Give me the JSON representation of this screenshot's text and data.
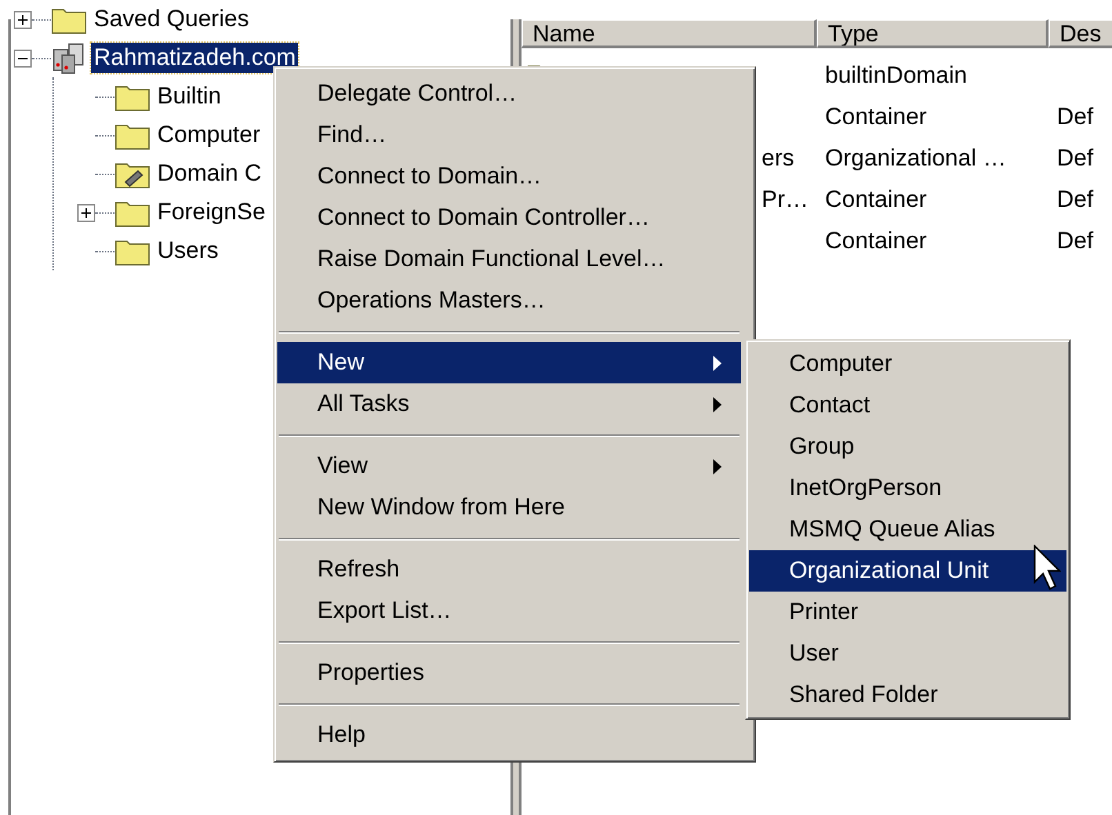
{
  "tree": {
    "items": [
      {
        "label": "Saved Queries",
        "kind": "folder",
        "expanded": false,
        "selected": false
      },
      {
        "label": "Rahmatizadeh.com",
        "kind": "domain",
        "expanded": true,
        "selected": true,
        "children": [
          {
            "label": "Builtin",
            "kind": "folder",
            "selected": false
          },
          {
            "label": "Computer",
            "kind": "folder",
            "selected": false
          },
          {
            "label": "Domain C",
            "kind": "ou",
            "selected": false
          },
          {
            "label": "ForeignSe",
            "kind": "folder",
            "expanded": false,
            "selected": false
          },
          {
            "label": "Users",
            "kind": "folder",
            "selected": false
          }
        ]
      }
    ]
  },
  "list": {
    "columns": [
      "Name",
      "Type",
      "Des"
    ],
    "rows": [
      {
        "kind": "folder",
        "type": "builtinDomain"
      },
      {
        "type": "Container",
        "description": "Def"
      },
      {
        "name": "ers",
        "type": "Organizational …",
        "description": "Def"
      },
      {
        "name": "Pr…",
        "type": "Container",
        "description": "Def"
      },
      {
        "type": "Container",
        "description": "Def"
      }
    ]
  },
  "context_menu": {
    "items": [
      {
        "kind": "item",
        "label": "Delegate Control…",
        "selected": false
      },
      {
        "kind": "item",
        "label": "Find…",
        "selected": false
      },
      {
        "kind": "item",
        "label": "Connect to Domain…",
        "selected": false
      },
      {
        "kind": "item",
        "label": "Connect to Domain Controller…",
        "selected": false
      },
      {
        "kind": "item",
        "label": "Raise Domain Functional Level…",
        "selected": false
      },
      {
        "kind": "item",
        "label": "Operations Masters…",
        "selected": false
      },
      {
        "kind": "separator"
      },
      {
        "kind": "submenu",
        "label": "New",
        "selected": true
      },
      {
        "kind": "submenu",
        "label": "All Tasks",
        "selected": false
      },
      {
        "kind": "separator"
      },
      {
        "kind": "submenu",
        "label": "View",
        "selected": false
      },
      {
        "kind": "item",
        "label": "New Window from Here",
        "selected": false
      },
      {
        "kind": "separator"
      },
      {
        "kind": "item",
        "label": "Refresh",
        "selected": false
      },
      {
        "kind": "item",
        "label": "Export List…",
        "selected": false
      },
      {
        "kind": "separator"
      },
      {
        "kind": "item",
        "label": "Properties",
        "selected": false
      },
      {
        "kind": "separator"
      },
      {
        "kind": "item",
        "label": "Help",
        "selected": false
      }
    ]
  },
  "submenu": {
    "items": [
      {
        "label": "Computer",
        "selected": false
      },
      {
        "label": "Contact",
        "selected": false
      },
      {
        "label": "Group",
        "selected": false
      },
      {
        "label": "InetOrgPerson",
        "selected": false
      },
      {
        "label": "MSMQ Queue Alias",
        "selected": false
      },
      {
        "label": "Organizational Unit",
        "selected": true
      },
      {
        "label": "Printer",
        "selected": false
      },
      {
        "label": "User",
        "selected": false
      },
      {
        "label": "Shared Folder",
        "selected": false
      }
    ]
  }
}
